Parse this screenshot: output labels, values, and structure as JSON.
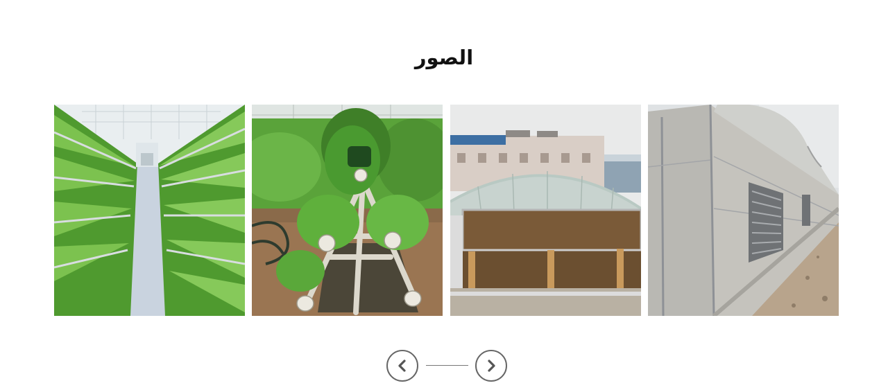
{
  "section": {
    "title": "الصور"
  },
  "gallery": {
    "images": [
      {
        "icon": "hydroponic-lettuce-greenhouse-photo"
      },
      {
        "icon": "vertical-hydroponic-celery-photo"
      },
      {
        "icon": "greenhouse-cooling-pad-photo"
      },
      {
        "icon": "polycarbonate-greenhouse-exterior-photo"
      }
    ]
  },
  "navigation": {
    "prev_icon": "chevron-left-icon",
    "next_icon": "chevron-right-icon"
  },
  "colors": {
    "title": "#111111",
    "nav_border": "#666666",
    "leaf_green": "#5aa83a",
    "sky": "#e6ebee"
  }
}
